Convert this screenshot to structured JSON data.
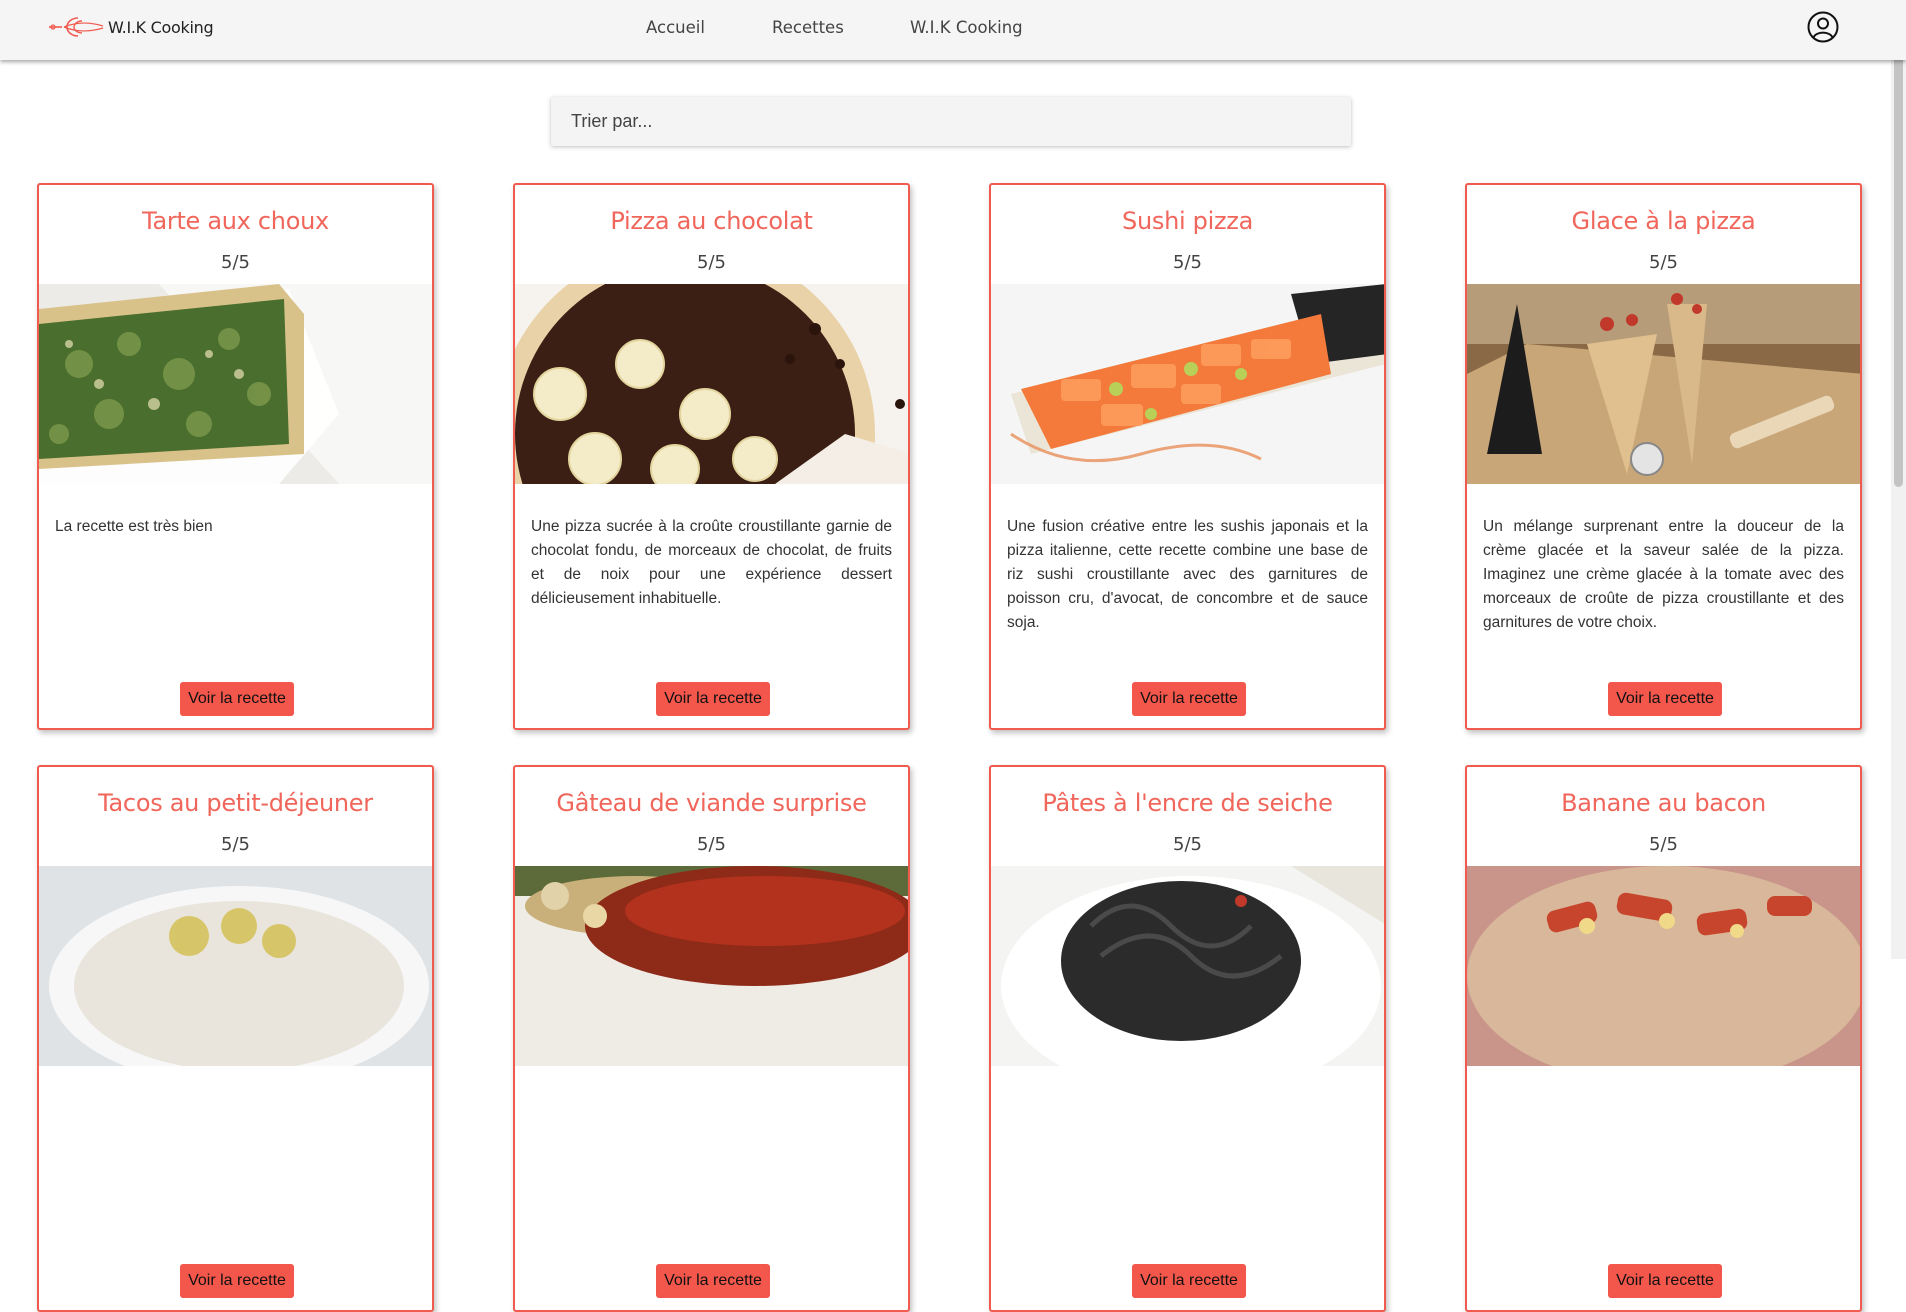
{
  "header": {
    "brand": "W.I.K Cooking",
    "nav": [
      "Accueil",
      "Recettes",
      "W.I.K Cooking"
    ],
    "icons": {
      "logo": "whisk-logo-icon",
      "account": "user-circle-icon"
    }
  },
  "sort": {
    "placeholder": "Trier par..."
  },
  "colors": {
    "accent": "#f0665b",
    "button": "#f3574c",
    "border": "#f05a4f",
    "header_bg": "#f5f5f5"
  },
  "recipes": [
    {
      "title": "Tarte aux choux",
      "rating": "5/5",
      "description": "La recette est très bien",
      "button": "Voir la recette"
    },
    {
      "title": "Pizza au chocolat",
      "rating": "5/5",
      "description": "Une pizza sucrée à la croûte croustillante garnie de chocolat fondu, de morceaux de chocolat, de fruits et de noix pour une expérience dessert délicieusement inhabituelle.",
      "button": "Voir la recette"
    },
    {
      "title": "Sushi pizza",
      "rating": "5/5",
      "description": "Une fusion créative entre les sushis japonais et la pizza italienne, cette recette combine une base de riz sushi croustillante avec des garnitures de poisson cru, d'avocat, de concombre et de sauce soja.",
      "button": "Voir la recette"
    },
    {
      "title": "Glace à la pizza",
      "rating": "5/5",
      "description": "Un mélange surprenant entre la douceur de la crème glacée et la saveur salée de la pizza. Imaginez une crème glacée à la tomate avec des morceaux de croûte de pizza croustillante et des garnitures de votre choix.",
      "button": "Voir la recette"
    },
    {
      "title": "Tacos au petit-déjeuner",
      "rating": "5/5",
      "description": "",
      "button": "Voir la recette"
    },
    {
      "title": "Gâteau de viande surprise",
      "rating": "5/5",
      "description": "",
      "button": "Voir la recette"
    },
    {
      "title": "Pâtes à l'encre de seiche",
      "rating": "5/5",
      "description": "",
      "button": "Voir la recette"
    },
    {
      "title": "Banane au bacon",
      "rating": "5/5",
      "description": "",
      "button": "Voir la recette"
    }
  ]
}
